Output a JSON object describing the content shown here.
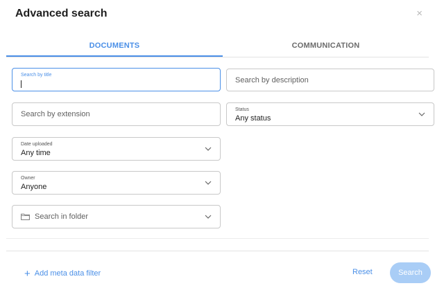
{
  "dialog": {
    "title": "Advanced search",
    "close_glyph": "×"
  },
  "tabs": [
    {
      "label": "DOCUMENTS",
      "active": true
    },
    {
      "label": "COMMUNICATION",
      "active": false
    }
  ],
  "fields": {
    "title": {
      "label": "Search by title",
      "value": ""
    },
    "description": {
      "placeholder": "Search by description"
    },
    "extension": {
      "placeholder": "Search by extension"
    },
    "status": {
      "label": "Status",
      "value": "Any status"
    },
    "date_uploaded": {
      "label": "Date uploaded",
      "value": "Any time"
    },
    "owner": {
      "label": "Owner",
      "value": "Anyone"
    },
    "folder": {
      "placeholder": "Search in folder"
    }
  },
  "footer": {
    "add_filter_icon": "+",
    "add_filter_label": "Add meta data filter",
    "reset_label": "Reset",
    "search_label": "Search"
  },
  "colors": {
    "accent": "#4a8fe7",
    "search_button_disabled": "#a9cdf6"
  }
}
